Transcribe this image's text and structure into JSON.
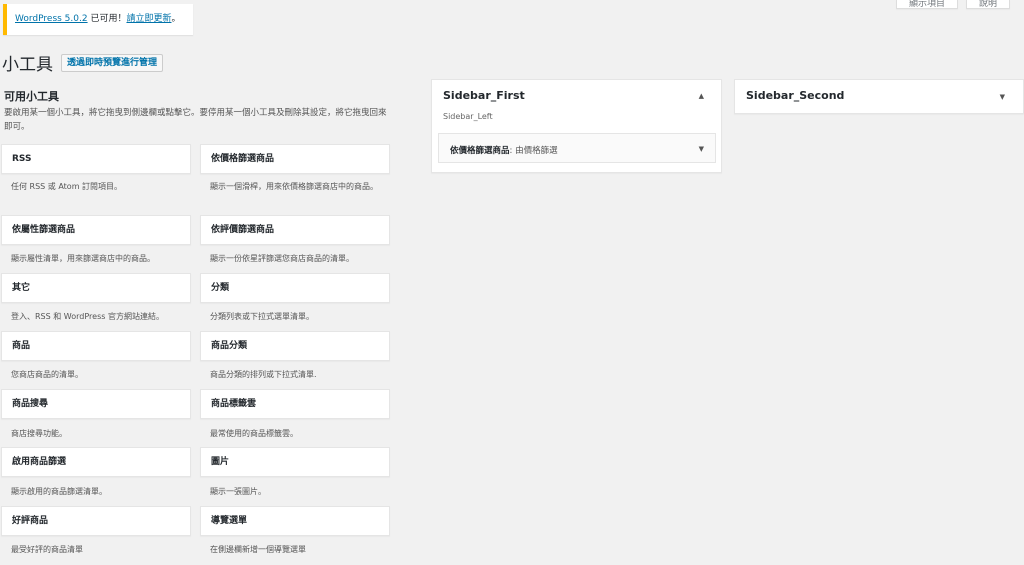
{
  "screen_options": {
    "label": "顯示項目"
  },
  "help": {
    "label": "說明"
  },
  "notice": {
    "version_link": "WordPress 5.0.2",
    "middle_text": " 已可用！",
    "update_link": "請立即更新",
    "end_text": "。"
  },
  "page": {
    "title": "小工具",
    "manage_button": "透過即時預覽進行管理"
  },
  "available": {
    "heading": "可用小工具",
    "description": "要啟用某一個小工具，將它拖曳到側邊欄或點擊它。要停用某一個小工具及刪除其設定，將它拖曳回來即可。",
    "widgets": [
      {
        "title": "RSS",
        "desc": "任何 RSS 或 Atom 訂閱項目。"
      },
      {
        "title": "依價格篩選商品",
        "desc": "顯示一個滑桿，用來依價格篩選商店中的商品。"
      },
      {
        "title": "依屬性篩選商品",
        "desc": "顯示屬性清單，用來篩選商店中的商品。"
      },
      {
        "title": "依評價篩選商品",
        "desc": "顯示一份依星評篩選您商店商品的清單。"
      },
      {
        "title": "其它",
        "desc": "登入、RSS 和 WordPress 官方網站連結。"
      },
      {
        "title": "分類",
        "desc": "分類列表或下拉式選單清單。"
      },
      {
        "title": "商品",
        "desc": "您商店商品的清單。"
      },
      {
        "title": "商品分類",
        "desc": "商品分類的排列或下拉式清單."
      },
      {
        "title": "商品搜尋",
        "desc": "商店搜尋功能。"
      },
      {
        "title": "商品標籤雲",
        "desc": "最常使用的商品標籤雲。"
      },
      {
        "title": "啟用商品篩選",
        "desc": "顯示啟用的商品篩選清單。"
      },
      {
        "title": "圖片",
        "desc": "顯示一張圖片。"
      },
      {
        "title": "好評商品",
        "desc": "最受好評的商品清單"
      },
      {
        "title": "導覽選單",
        "desc": "在側邊欄新增一個導覽選單"
      }
    ]
  },
  "sidebars": {
    "first": {
      "title": "Sidebar_First",
      "description": "Sidebar_Left",
      "widget": {
        "name": "依價格篩選商品",
        "instance": ": 由價格篩選"
      }
    },
    "second": {
      "title": "Sidebar_Second"
    }
  },
  "colors": {
    "link": "#0073aa",
    "notice_border": "#ffb900",
    "background": "#f1f1f1"
  }
}
